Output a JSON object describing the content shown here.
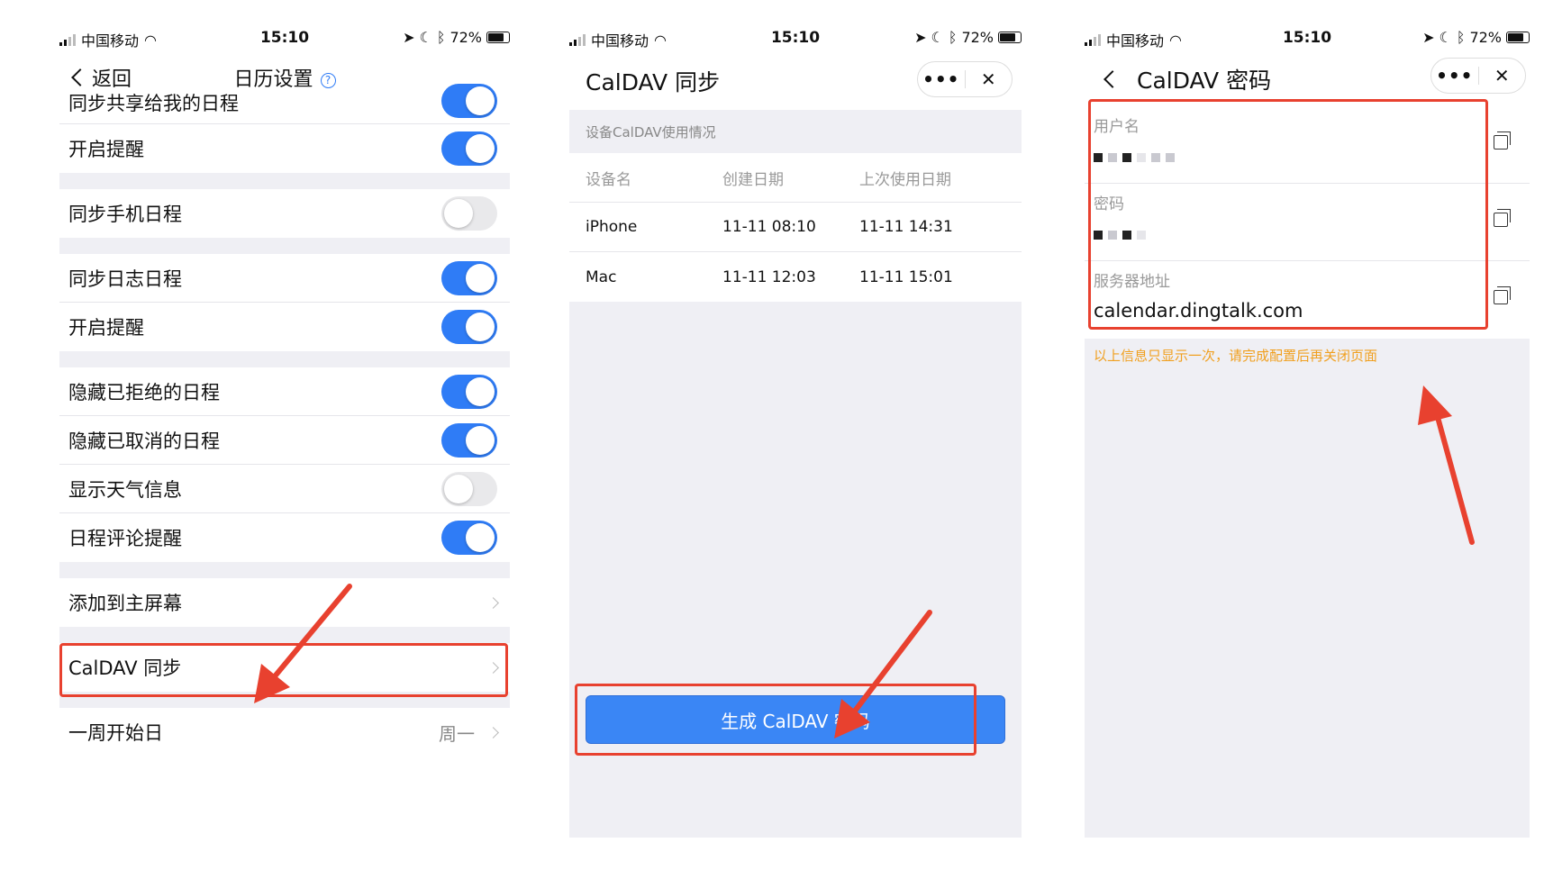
{
  "status": {
    "carrier": "中国移动",
    "time": "15:10",
    "battery": "72%"
  },
  "panel1": {
    "back_label": "返回",
    "title": "日历设置",
    "rows": [
      {
        "label": "同步共享给我的日程",
        "toggle": true
      },
      {
        "label": "开启提醒",
        "toggle": true
      },
      {
        "label": "同步手机日程",
        "toggle": false
      },
      {
        "label": "同步日志日程",
        "toggle": true
      },
      {
        "label": "开启提醒",
        "toggle": true
      },
      {
        "label": "隐藏已拒绝的日程",
        "toggle": true
      },
      {
        "label": "隐藏已取消的日程",
        "toggle": true
      },
      {
        "label": "显示天气信息",
        "toggle": false
      },
      {
        "label": "日程评论提醒",
        "toggle": true
      },
      {
        "label": "添加到主屏幕"
      },
      {
        "label": "CalDAV 同步"
      },
      {
        "label": "一周开始日",
        "value": "周一"
      }
    ]
  },
  "panel2": {
    "title": "CalDAV 同步",
    "section": "设备CalDAV使用情况",
    "columns": [
      "设备名",
      "创建日期",
      "上次使用日期"
    ],
    "devices": [
      {
        "name": "iPhone",
        "created": "11-11 08:10",
        "last_used": "11-11 14:31"
      },
      {
        "name": "Mac",
        "created": "11-11 12:03",
        "last_used": "11-11 15:01"
      }
    ],
    "button": "生成 CalDAV 密码"
  },
  "panel3": {
    "title": "CalDAV 密码",
    "fields": [
      {
        "label": "用户名",
        "value": ""
      },
      {
        "label": "密码",
        "value": ""
      },
      {
        "label": "服务器地址",
        "value": "calendar.dingtalk.com"
      }
    ],
    "notice": "以上信息只显示一次，请完成配置后再关闭页面"
  },
  "colors": {
    "accent": "#2f7cf6",
    "highlight": "#e8412f",
    "notice": "#f0a020"
  },
  "icons": [
    "signal-icon",
    "wifi-icon",
    "battery-icon",
    "help-icon",
    "chevron-left-icon",
    "chevron-right-icon",
    "more-icon",
    "close-icon",
    "copy-icon",
    "arrow-annotation"
  ]
}
